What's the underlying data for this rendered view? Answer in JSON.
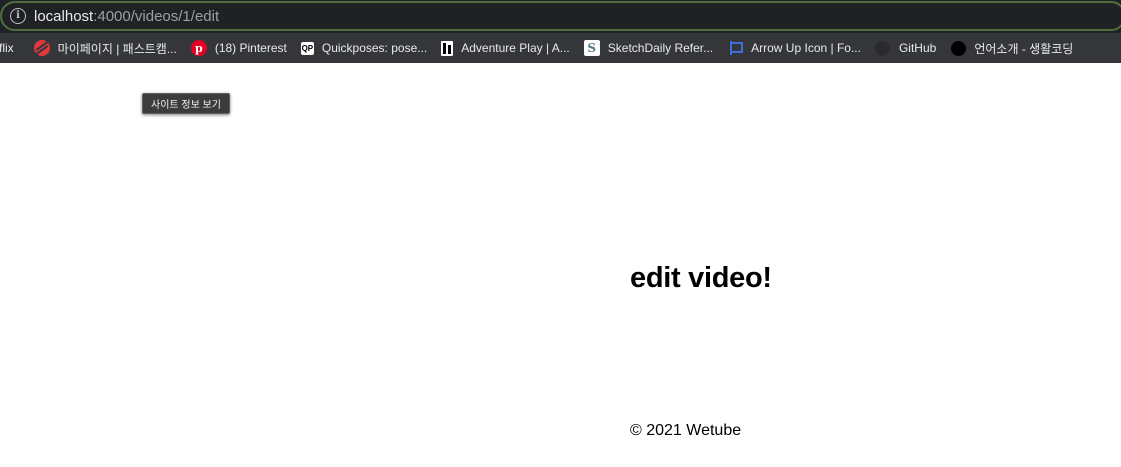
{
  "address_bar": {
    "url_host": "localhost",
    "url_rest": ":4000/videos/1/edit",
    "info_icon": "info-icon"
  },
  "bookmarks": [
    {
      "label": "flix",
      "icon": ""
    },
    {
      "label": "마이페이지 | 패스트캠...",
      "icon": "red-circle-icon"
    },
    {
      "label": "(18) Pinterest",
      "icon": "pinterest-icon"
    },
    {
      "label": "Quickposes: pose...",
      "icon": "quickposes-icon"
    },
    {
      "label": "Adventure Play | A...",
      "icon": "adventure-play-icon"
    },
    {
      "label": "SketchDaily Refer...",
      "icon": "sketchdaily-icon"
    },
    {
      "label": "Arrow Up Icon | Fo...",
      "icon": "flag-icon"
    },
    {
      "label": "GitHub",
      "icon": "github-icon"
    },
    {
      "label": "언어소개 - 생활코딩",
      "icon": "black-circle-icon"
    }
  ],
  "tooltip": {
    "text": "사이트 정보 보기"
  },
  "page": {
    "title": "edit video!",
    "footer": "© 2021 Wetube"
  }
}
